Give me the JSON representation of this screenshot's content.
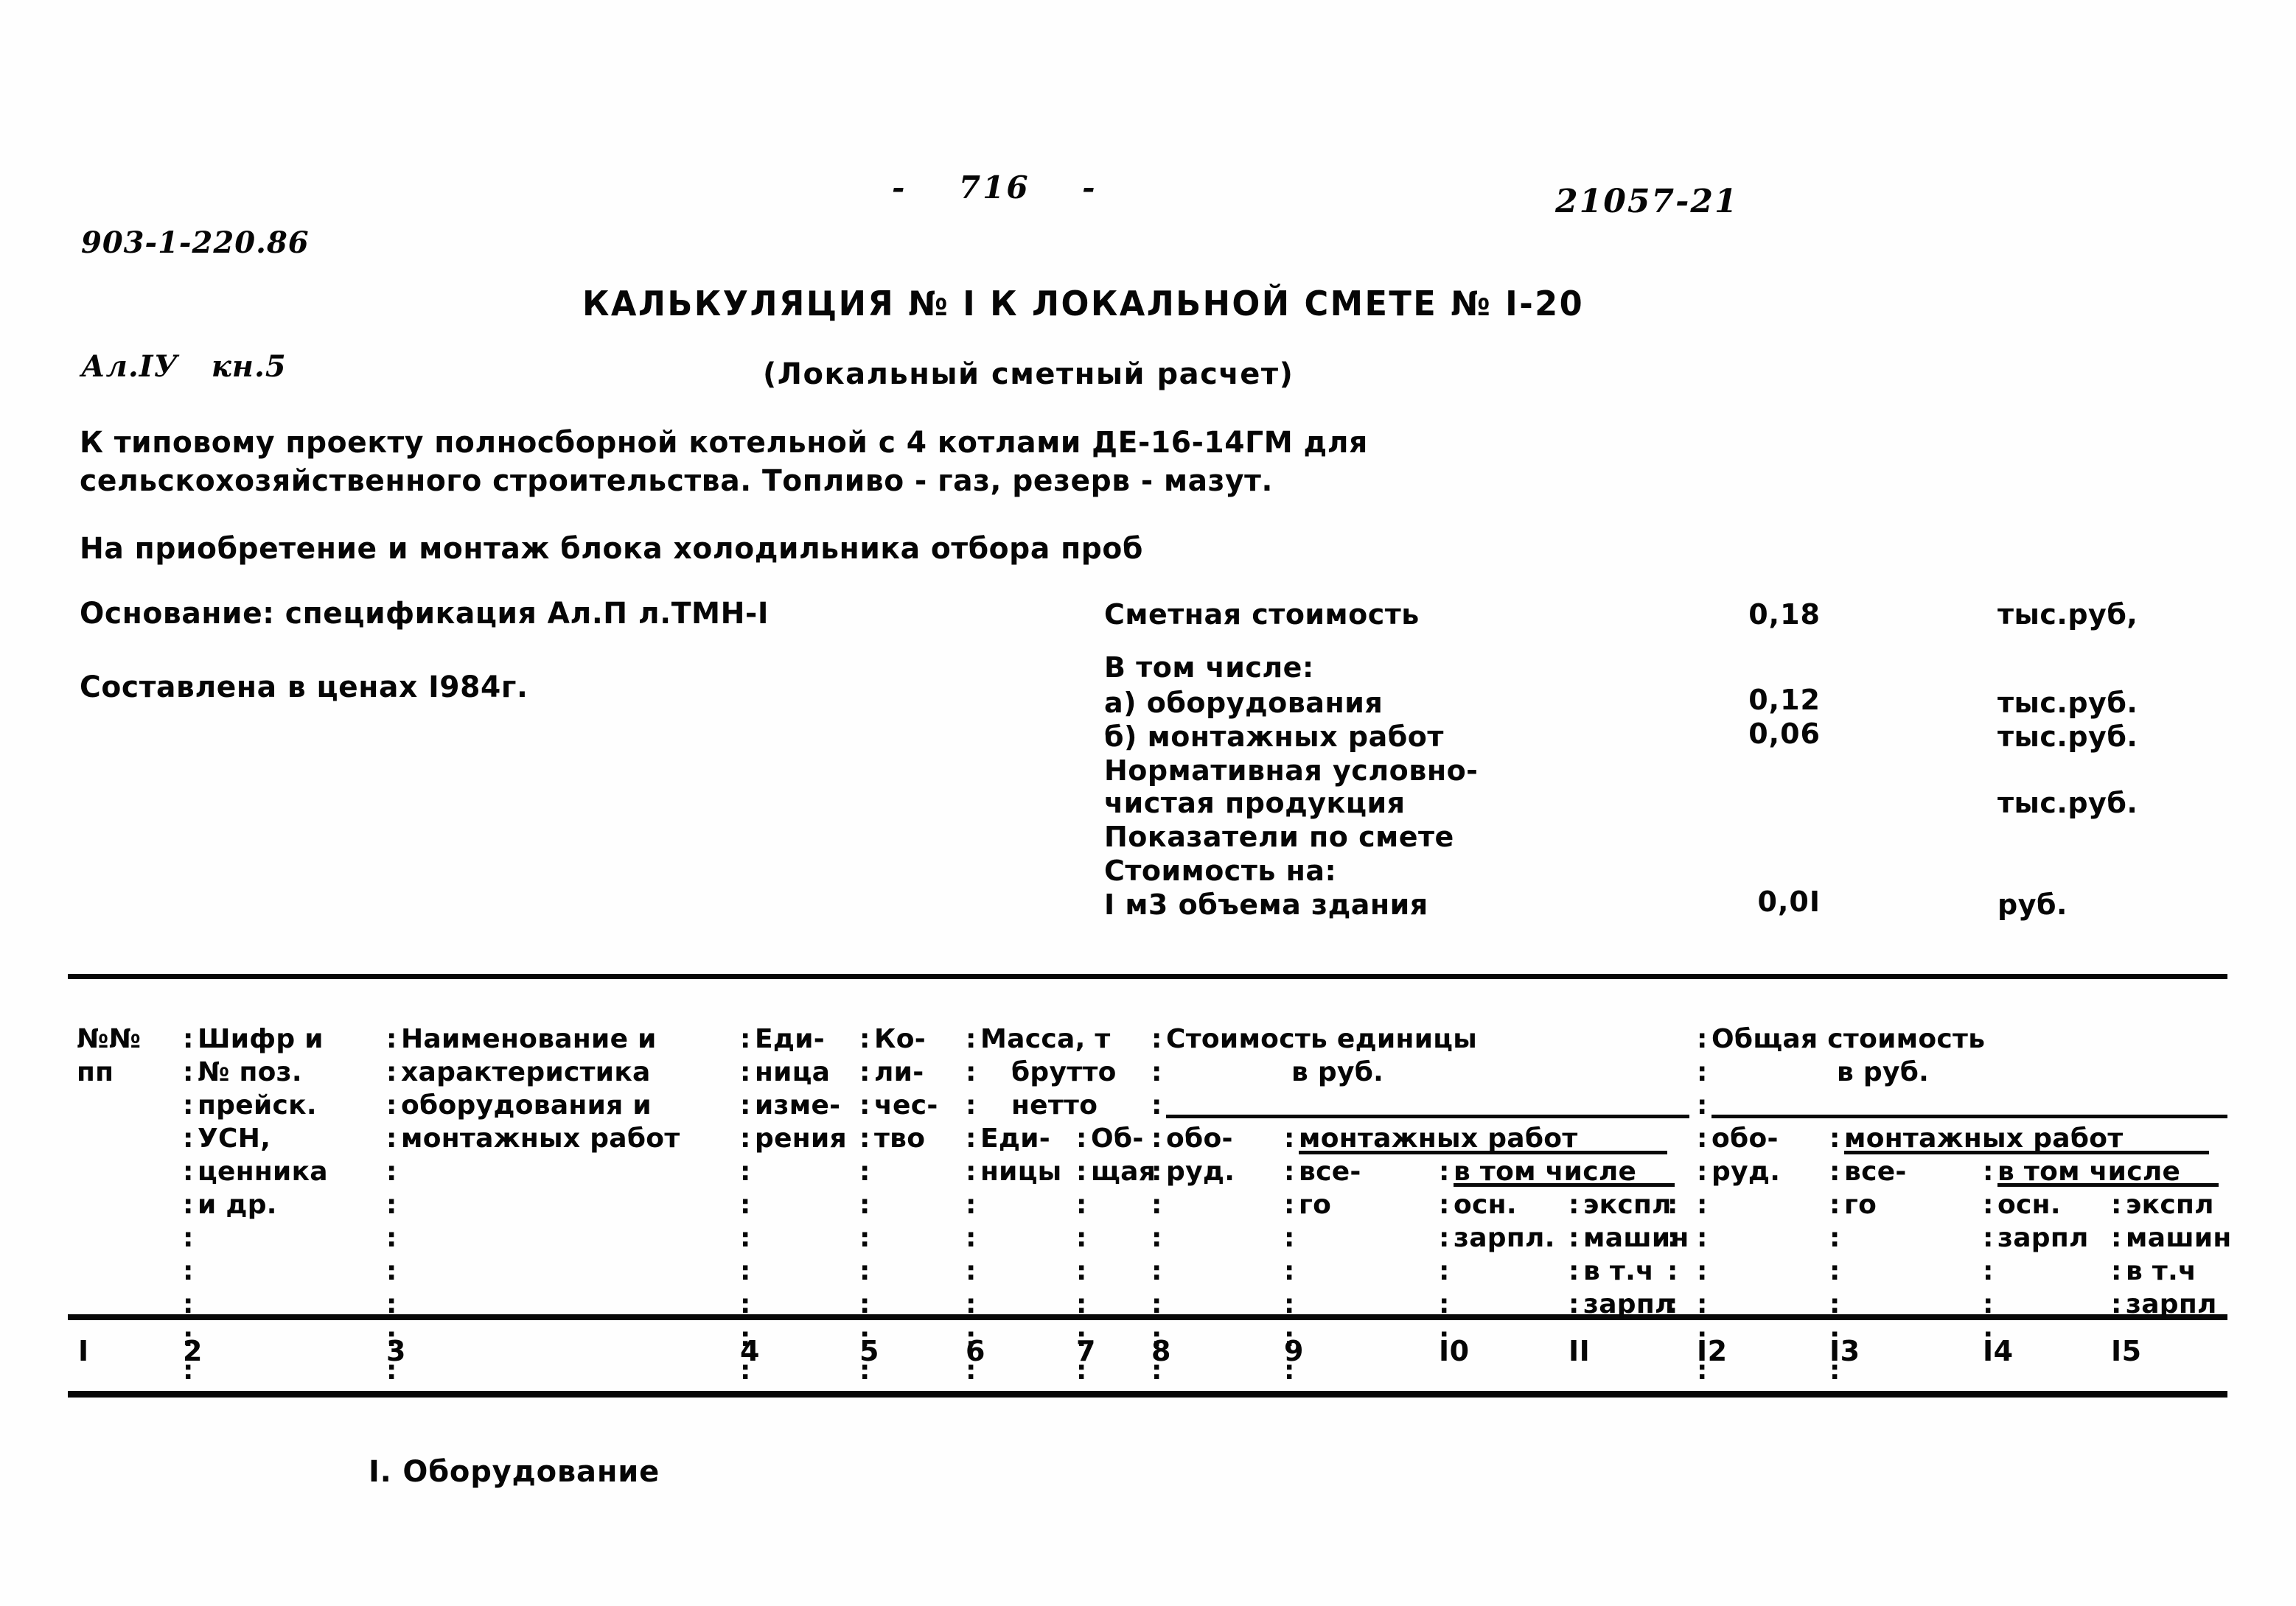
{
  "header": {
    "stamp_line1": "903-1-220.86",
    "stamp_line2": "Ал.IУ   кн.5",
    "page_number": "-    716    -",
    "doc_code": "21057-21"
  },
  "title": {
    "main": "КАЛЬКУЛЯЦИЯ № I К ЛОКАЛЬНОЙ СМЕТЕ № I-20",
    "subtitle": "(Локальный сметный расчет)"
  },
  "description": {
    "line1": "К типовому проекту полносборной котельной с 4 котлами ДЕ-16-14ГМ для",
    "line2": "сельскохозяйственного строительства. Топливо - газ, резерв - мазут.",
    "purpose": "На приобретение и монтаж блока холодильника отбора проб"
  },
  "basis": {
    "basis_label": "Основание: спецификация Ал.П л.ТМН-I",
    "prices_label": "Составлена в ценах I984г."
  },
  "cost_summary": [
    {
      "label": "Сметная стоимость",
      "value": "0,18",
      "unit": "тыс.руб,"
    },
    {
      "label": "В том числе:",
      "value": "",
      "unit": ""
    },
    {
      "label": "а) оборудования",
      "value": "0,12",
      "unit": "тыс.руб."
    },
    {
      "label": "б) монтажных работ",
      "value": "0,06",
      "unit": "тыс.руб."
    },
    {
      "label": "Нормативная условно-",
      "value": "",
      "unit": ""
    },
    {
      "label": "чистая продукция",
      "value": "",
      "unit": "тыс.руб."
    },
    {
      "label": "Показатели по смете",
      "value": "",
      "unit": ""
    },
    {
      "label": "Стоимость на:",
      "value": "",
      "unit": ""
    },
    {
      "label": "I м3 объема здания",
      "value": "0,0I",
      "unit": "руб."
    }
  ],
  "table": {
    "headers": {
      "col1": "№№\nпп",
      "col2": "Шифр и\n№ поз.\nпрейск.\nУСН,\nценника\nи др.",
      "col3": "Наименование и\nхарактеристика\nоборудования и\nмонтажных работ",
      "col4": "Еди-\nница\nизме-\nрения",
      "col5": "Ко-\nли-\nчес-\nтво",
      "col6_group": "Масса, т",
      "col6_brutto": "брутто",
      "col6_netto": "нетто",
      "col6": "Еди-\nницы",
      "col7": "Об-\nщая",
      "unit_cost_group": "Стоимость единицы",
      "unit_cost_currency": "в руб.",
      "col8": "обо-\nруд.",
      "col9_10_11_group": "монтажных работ",
      "col9": "все-\nго",
      "col10_11_group": "в том числе",
      "col10": "осн.\nзарпл.",
      "col11": "экспл\nмашин\nв т.ч\nзарпл",
      "total_cost_group": "Общая стоимость",
      "total_cost_currency": "в руб.",
      "col12": "обо-\nруд.",
      "col13_14_15_group": "монтажных работ",
      "col13": "все-\nго",
      "col14_15_group": "в том числе",
      "col14": "осн.\nзарпл",
      "col15": "экспл\nмашин\nв т.ч\nзарпл"
    },
    "column_numbers": [
      "I",
      "2",
      "3",
      "4",
      "5",
      "6",
      "7",
      "8",
      "9",
      "I0",
      "II",
      "I2",
      "I3",
      "I4",
      "I5"
    ]
  },
  "body": {
    "section_heading": "I. Оборудование"
  }
}
